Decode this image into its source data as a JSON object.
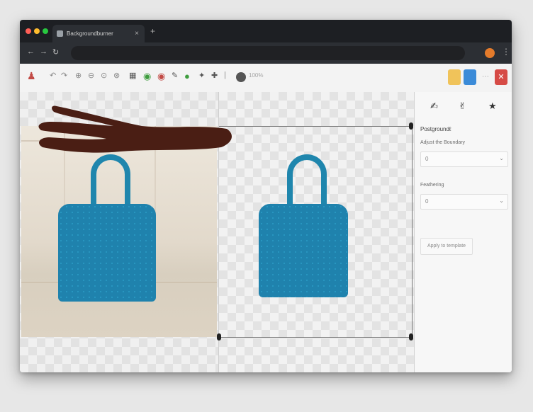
{
  "browser": {
    "tab_title": "Backgroundburner",
    "new_tab": "+",
    "url": "",
    "close_tab": "×"
  },
  "toolbar": {
    "zoom_label": "100%"
  },
  "panel": {
    "title": "Postgroundℓ",
    "label_1": "Adjust the Boundary",
    "value_1": "0",
    "label_2": "Feathering",
    "value_2": "0",
    "apply_button": "Apply to template"
  },
  "colors": {
    "accent_yellow": "#f0c35a",
    "accent_blue": "#3b8bd8",
    "accent_red": "#d64b46",
    "bag_teal": "#1f86ad"
  },
  "icons": {
    "tool_1": "undo-icon",
    "tool_2": "redo-icon",
    "panel_1": "brush-icon",
    "panel_2": "eraser-icon",
    "panel_3": "star-icon"
  }
}
